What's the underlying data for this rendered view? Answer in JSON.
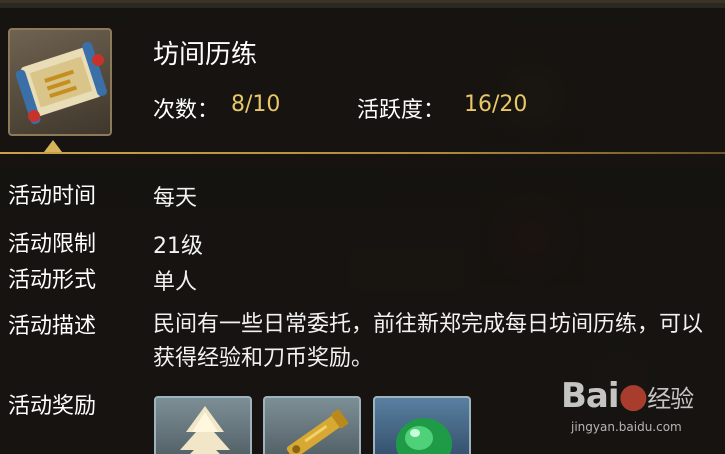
{
  "tooltip": {
    "title": "坊间历练",
    "count_label": "次数：",
    "count_value": "8/10",
    "activity_label": "活跃度：",
    "activity_value": "16/20",
    "icon": "scroll-icon"
  },
  "details": [
    {
      "label": "活动时间",
      "value": "每天"
    },
    {
      "label": "活动限制",
      "value": "21级"
    },
    {
      "label": "活动形式",
      "value": "单人"
    },
    {
      "label": "活动描述",
      "value": "民间有一些日常委托，前往新郑完成每日坊间历练，可以获得经验和刀币奖励。"
    },
    {
      "label": "活动奖励",
      "value": ""
    }
  ],
  "rewards": [
    {
      "icon": "experience-tree-icon"
    },
    {
      "icon": "knife-coin-icon"
    },
    {
      "icon": "green-gem-icon"
    }
  ],
  "watermark": {
    "logo_text": "Bai",
    "logo_cn": "经验",
    "url": "jingyan.baidu.com"
  },
  "colors": {
    "highlight": "#e8c766",
    "divider": "#c9a24b"
  }
}
